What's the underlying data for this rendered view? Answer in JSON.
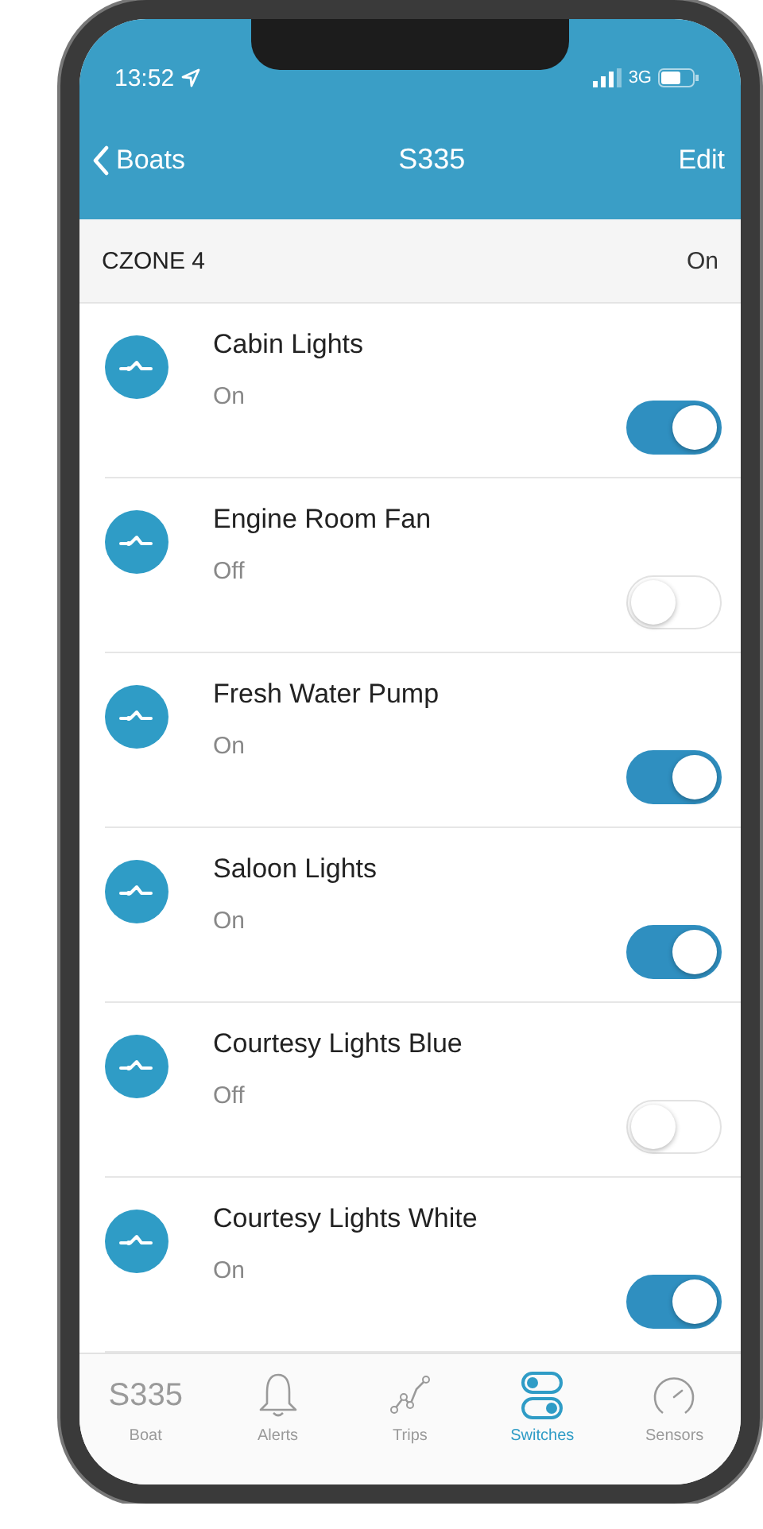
{
  "status_bar": {
    "time": "13:52",
    "network": "3G"
  },
  "nav": {
    "back": "Boats",
    "title": "S335",
    "action": "Edit"
  },
  "section": {
    "title": "CZONE 4",
    "state": "On"
  },
  "switches": [
    {
      "name": "Cabin Lights",
      "state": "On",
      "on": true
    },
    {
      "name": "Engine Room Fan",
      "state": "Off",
      "on": false
    },
    {
      "name": "Fresh Water Pump",
      "state": "On",
      "on": true
    },
    {
      "name": "Saloon Lights",
      "state": "On",
      "on": true
    },
    {
      "name": "Courtesy Lights Blue",
      "state": "Off",
      "on": false
    },
    {
      "name": "Courtesy Lights White",
      "state": "On",
      "on": true
    }
  ],
  "tabs": [
    {
      "kind": "text",
      "glyph": "S335",
      "label": "Boat",
      "selected": false
    },
    {
      "kind": "bell",
      "label": "Alerts",
      "selected": false
    },
    {
      "kind": "trips",
      "label": "Trips",
      "selected": false
    },
    {
      "kind": "switches",
      "label": "Switches",
      "selected": true
    },
    {
      "kind": "gauge",
      "label": "Sensors",
      "selected": false
    }
  ]
}
